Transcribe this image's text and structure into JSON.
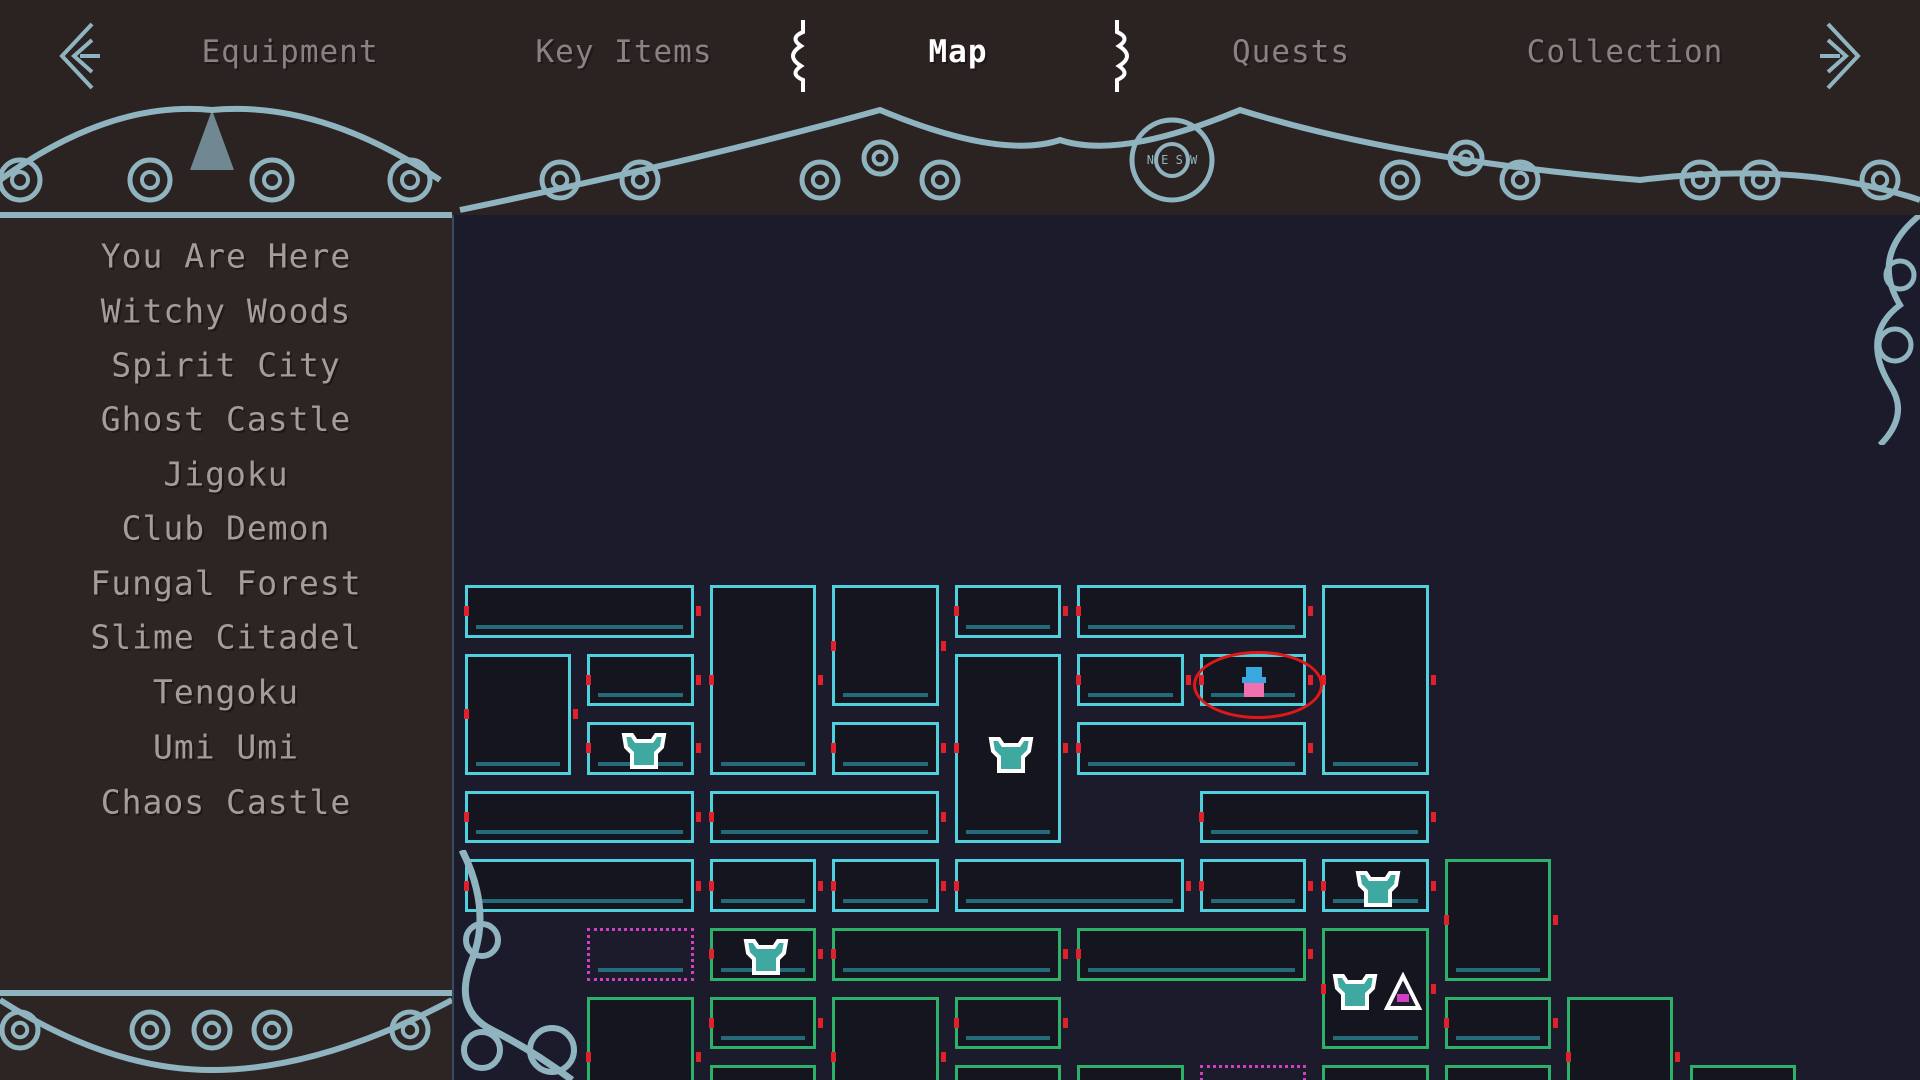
{
  "tabs": {
    "items": [
      {
        "label": "Equipment",
        "active": false
      },
      {
        "label": "Key Items",
        "active": false
      },
      {
        "label": "Map",
        "active": true
      },
      {
        "label": "Quests",
        "active": false
      },
      {
        "label": "Collection",
        "active": false
      }
    ],
    "prev_icon": "arrow-left-icon",
    "next_icon": "arrow-right-icon"
  },
  "regions": [
    {
      "label": "You Are Here"
    },
    {
      "label": "Witchy Woods"
    },
    {
      "label": "Spirit City"
    },
    {
      "label": "Ghost Castle"
    },
    {
      "label": "Jigoku"
    },
    {
      "label": "Club Demon"
    },
    {
      "label": "Fungal Forest"
    },
    {
      "label": "Slime Citadel"
    },
    {
      "label": "Tengoku"
    },
    {
      "label": "Umi Umi"
    },
    {
      "label": "Chaos Castle"
    }
  ],
  "map": {
    "compass_letters": "N E S W",
    "markers": {
      "player": "witch-player-icon",
      "relic": "relic-cup-icon",
      "shrine": "shrine-icon"
    },
    "colors": {
      "explored_room": "#4fd0dc",
      "area_room": "#2fb06a",
      "unexplored_room": "#d040c0",
      "door": "#e0202a",
      "player_circle": "#e01818"
    }
  }
}
